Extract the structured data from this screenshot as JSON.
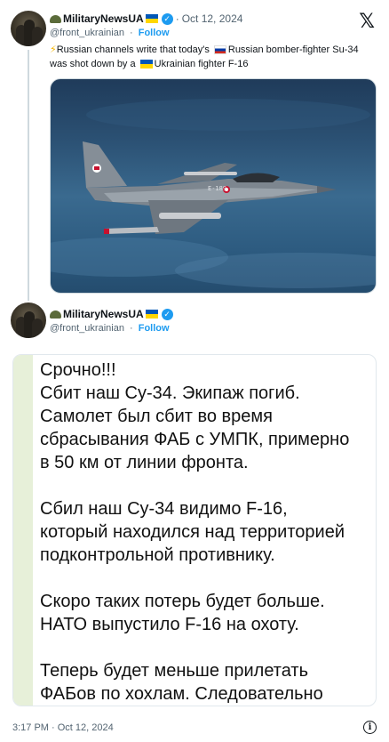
{
  "post": {
    "author": {
      "display_name": "MilitaryNewsUA",
      "handle": "@front_ukrainian",
      "follow_label": "Follow",
      "separator": "·"
    },
    "date": "Oct 12, 2024",
    "text_parts": {
      "a": "Russian channels write that today's ",
      "b": "Russian bomber-fighter Su-34 was shot down by a ",
      "c": "Ukrainian fighter F-16"
    },
    "media": {
      "subject": "F-16 fighter jet over sea",
      "serial_mark": "E-189"
    }
  },
  "quoted": {
    "author": {
      "display_name": "MilitaryNewsUA",
      "handle": "@front_ukrainian",
      "follow_label": "Follow",
      "separator": "·"
    },
    "body": "Срочно!!!\nСбит наш Су-34. Экипаж погиб.\nСамолет был сбит во время\nсбрасывания ФАБ с УМПК, примерно\nв 50 км от линии фронта.\n\nСбил наш Су-34 видимо F-16,\nкоторый находился над территорией\nподконтрольной противнику.\n\nСкоро таких потерь будет больше.\nНАТО выпустило F-16 на охоту.\n\nТеперь будет меньше прилетать\nФАБов по хохлам. Следовательно\nпотери нашей пехоты возрастут."
  },
  "footer": {
    "timestamp": "3:17 PM · Oct 12, 2024"
  },
  "icons": {
    "x_logo": "𝕏",
    "info": "i",
    "verified": "✓",
    "bolt": "⚡"
  },
  "colors": {
    "link": "#1d9bf0",
    "muted": "#536471",
    "text": "#0f1419",
    "quote_accent": "#e7f0d9"
  }
}
